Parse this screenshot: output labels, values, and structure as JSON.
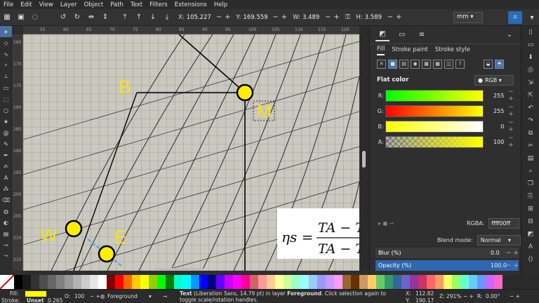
{
  "menu": [
    "File",
    "Edit",
    "View",
    "Layer",
    "Object",
    "Path",
    "Text",
    "Filters",
    "Extensions",
    "Help"
  ],
  "toolctrl": {
    "x_label": "X:",
    "x_value": "105.227",
    "y_label": "Y:",
    "y_value": "169.559",
    "w_label": "W:",
    "w_value": "3.489",
    "h_label": "H:",
    "h_value": "3.589",
    "unit": "mm"
  },
  "ruler": {
    "h_ticks": [
      "55",
      "60",
      "65",
      "70",
      "75",
      "80",
      "85",
      "90",
      "95",
      "100",
      "105",
      "110",
      "115",
      "120"
    ],
    "v_ticks": [
      "165",
      "170",
      "175",
      "180",
      "185",
      "190",
      "195",
      "200",
      "205",
      "210",
      "215"
    ]
  },
  "canvas": {
    "labels": {
      "b": "B",
      "m": "M",
      "w": "W",
      "e": "E"
    },
    "formula_lhs": "ηs =",
    "formula_num": "TA − T",
    "formula_den": "TA − T",
    "point_color": "#ffee00",
    "label_color": "#f4e21a"
  },
  "panel": {
    "tabs": {
      "fill": "Fill",
      "stroke_paint": "Stroke paint",
      "stroke_style": "Stroke style"
    },
    "flat_color": "Flat color",
    "color_mode": "RGB",
    "channels": [
      {
        "label": "R:",
        "value": "255"
      },
      {
        "label": "G:",
        "value": "255"
      },
      {
        "label": "B:",
        "value": "0"
      },
      {
        "label": "A:",
        "value": "100"
      }
    ],
    "rgba_label": "RGBA:",
    "rgba_value": "ffff00ff",
    "blend_label": "Blend mode:",
    "blend_value": "Normal",
    "blur_label": "Blur (%)",
    "blur_value": "0.0",
    "opacity_label": "Opacity (%)",
    "opacity_value": "100.0",
    "opacity_fraction": 1.0
  },
  "statusbar": {
    "fill_label": "Fill:",
    "stroke_label": "Stroke:",
    "stroke_value": "Unset",
    "stroke_width": "0.265",
    "o_label": "O:",
    "o_value": "100",
    "layer": "Foreground",
    "message_bold": "Text",
    "message_rest": " (Liberation Sans, 14.79 pt) in layer ",
    "message_layer": "Foreground",
    "message_tail": ". Click selection again to toggle scale/rotation handles.",
    "x_label": "X:",
    "x_value": "112.82",
    "y_label": "Y:",
    "y_value": "190.17",
    "z_label": "Z:",
    "z_value": "291%",
    "r_label": "R:",
    "r_value": "0.00°"
  },
  "palette_colors": [
    "#000000",
    "#1a1a1a",
    "#333333",
    "#4d4d4d",
    "#666666",
    "#808080",
    "#999999",
    "#b3b3b3",
    "#cccccc",
    "#e6e6e6",
    "#ffffff",
    "#800000",
    "#ff0000",
    "#ff6600",
    "#ffcc00",
    "#ffff00",
    "#99cc00",
    "#00ff00",
    "#008000",
    "#00ffcc",
    "#00ffff",
    "#0099ff",
    "#0000ff",
    "#000080",
    "#6600ff",
    "#cc00ff",
    "#ff00ff",
    "#ff0099",
    "#cc6666",
    "#ff9999",
    "#ffcc99",
    "#ffff99",
    "#ccff99",
    "#99ffcc",
    "#99ffff",
    "#99ccff",
    "#9999ff",
    "#cc99ff",
    "#ff99ff",
    "#996633",
    "#663300",
    "#cc9966",
    "#ffcc66",
    "#66cc66",
    "#339966",
    "#336699",
    "#6666cc",
    "#993399",
    "#cc3366",
    "#ff6666",
    "#ff9966",
    "#ffff66",
    "#99ff66",
    "#66ffcc",
    "#66ccff",
    "#6699ff",
    "#cc66ff",
    "#ff66cc"
  ]
}
